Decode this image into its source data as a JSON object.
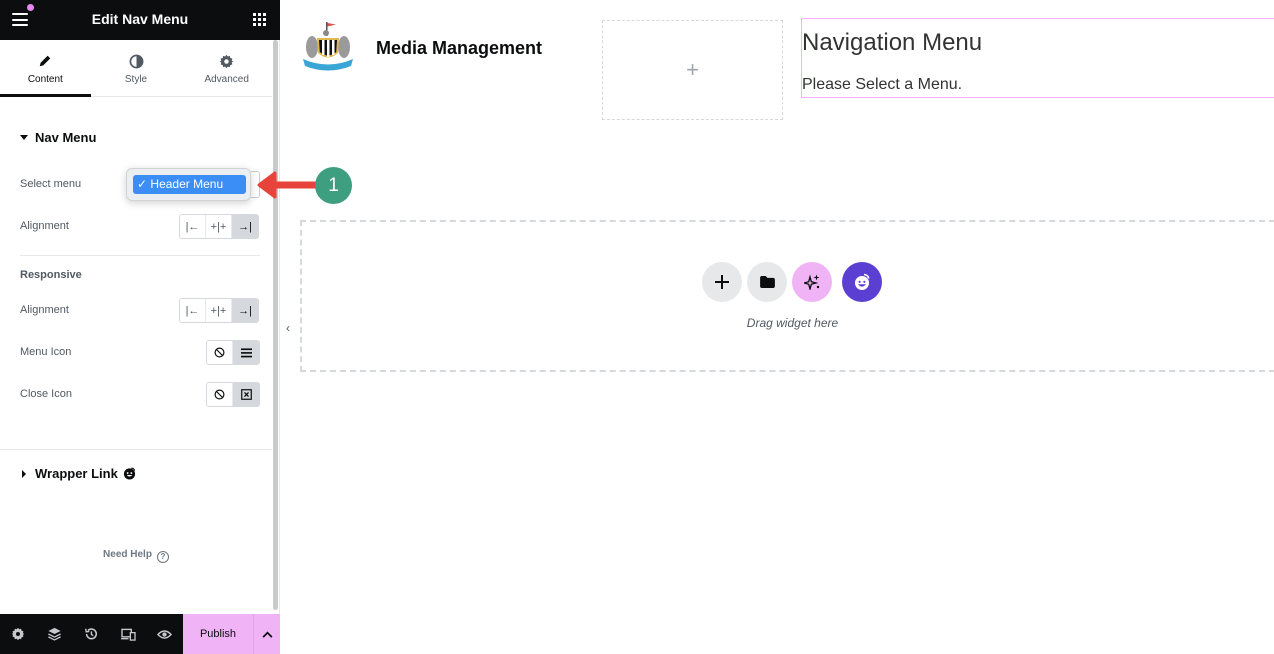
{
  "sidebar": {
    "title": "Edit Nav Menu",
    "tabs": [
      {
        "label": "Content",
        "icon": "pencil-icon",
        "active": true
      },
      {
        "label": "Style",
        "icon": "half-circle-icon",
        "active": false
      },
      {
        "label": "Advanced",
        "icon": "gear-icon",
        "active": false
      }
    ],
    "nav_menu_section": {
      "title": "Nav Menu",
      "select_menu_label": "Select menu",
      "select_menu_value": "Header Menu",
      "select_menu_checkmark": "✓",
      "alignment_label": "Alignment",
      "alignment_options": [
        "start",
        "center",
        "end"
      ],
      "alignment_selected": "end"
    },
    "responsive_section": {
      "title": "Responsive",
      "alignment_label": "Alignment",
      "alignment_selected": "end",
      "menu_icon_label": "Menu Icon",
      "menu_icon_selected": "hamburger",
      "close_icon_label": "Close Icon",
      "close_icon_selected": "x-box"
    },
    "wrapper_link_section": {
      "title": "Wrapper Link"
    },
    "need_help": "Need Help",
    "help_symbol": "?"
  },
  "bottom_bar": {
    "icons": [
      "settings-icon",
      "layers-icon",
      "history-icon",
      "responsive-icon",
      "preview-icon"
    ],
    "publish_label": "Publish"
  },
  "canvas": {
    "site_title": "Media Management",
    "empty_column_symbol": "+",
    "nav_widget": {
      "title": "Navigation Menu",
      "message": "Please Select a Menu."
    },
    "drop_area": {
      "text": "Drag widget here",
      "buttons": [
        "add-section",
        "template-library",
        "ai-assistant",
        "elementor-kit"
      ]
    },
    "collapse_symbol": "‹"
  },
  "annotation": {
    "step_number": "1",
    "arrow_color": "#e8433a",
    "badge_color": "#3e9e80"
  },
  "colors": {
    "accent_pink": "#f0b3f5",
    "select_blue": "#3b8ef5",
    "dark": "#0c0d0e",
    "kit_purple": "#5b3fd3"
  }
}
